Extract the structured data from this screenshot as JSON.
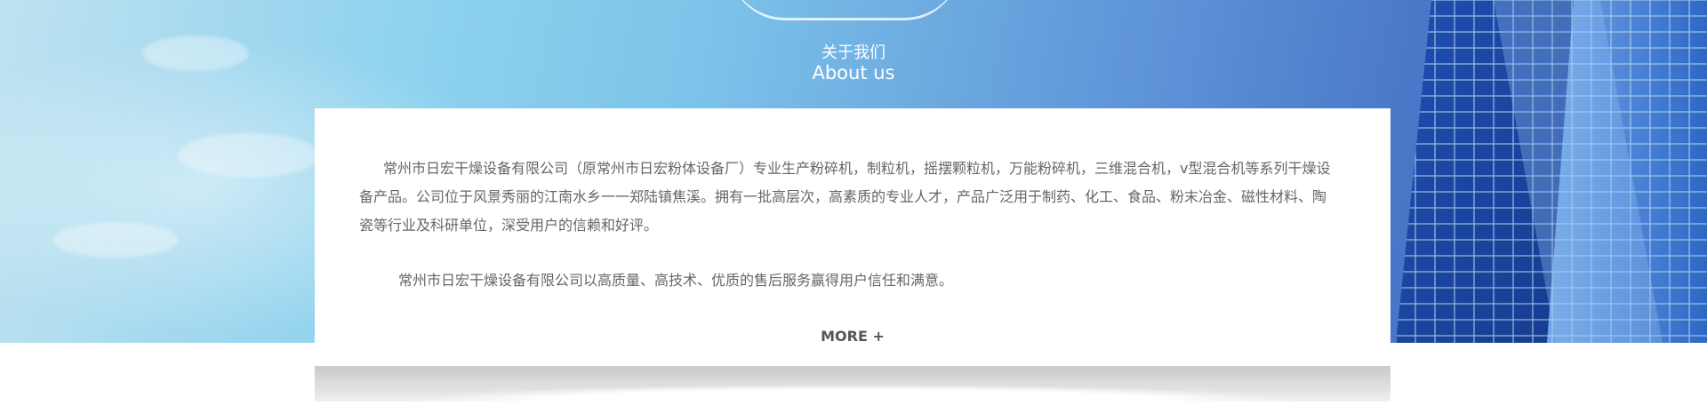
{
  "about": {
    "title_cn": "关于我们",
    "title_en": "About us",
    "paragraph_1": "常州市日宏干燥设备有限公司（原常州市日宏粉体设备厂）专业生产粉碎机，制粒机，摇摆颗粒机，万能粉碎机，三维混合机，v型混合机等系列干燥设备产品。公司位于风景秀丽的江南水乡一一郑陆镇焦溪。拥有一批高层次，高素质的专业人才，产品广泛用于制药、化工、食品、粉末冶金、磁性材料、陶瓷等行业及科研单位，深受用户的信赖和好评。",
    "paragraph_2": "常州市日宏干燥设备有限公司以高质量、高技术、优质的售后服务赢得用户信任和满意。",
    "more_label": "MORE +"
  },
  "colors": {
    "banner_blue": "#5b8fd6",
    "text_gray": "#666666",
    "title_white": "#ffffff"
  }
}
